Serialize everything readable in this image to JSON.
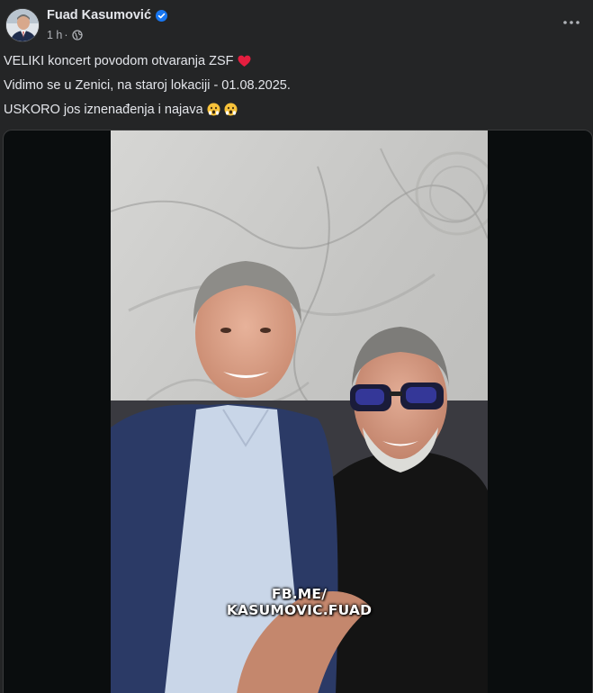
{
  "post": {
    "author_name": "Fuad Kasumović",
    "timestamp": "1 h",
    "separator": "·",
    "audience_icon": "globe-icon",
    "verified_icon": "verified-badge-icon",
    "more_icon": "more-options-icon",
    "text_lines": [
      "VELIKI koncert povodom otvaranja ZSF",
      "Vidimo se u Zenici, na staroj lokaciji - 01.08.2025.",
      "USKORO jos iznenađenja i najava"
    ],
    "line_emojis": [
      "heart-emoji",
      "",
      "astonished-face-emoji"
    ],
    "media": {
      "watermark_line1": "FB.ME/",
      "watermark_line2": "KASUMOVIC.FUAD"
    }
  },
  "colors": {
    "background": "#242526",
    "primary_text": "#e4e6eb",
    "secondary_text": "#b0b3b8",
    "verified_blue": "#1877f2",
    "heart_red": "#e41e3f"
  }
}
